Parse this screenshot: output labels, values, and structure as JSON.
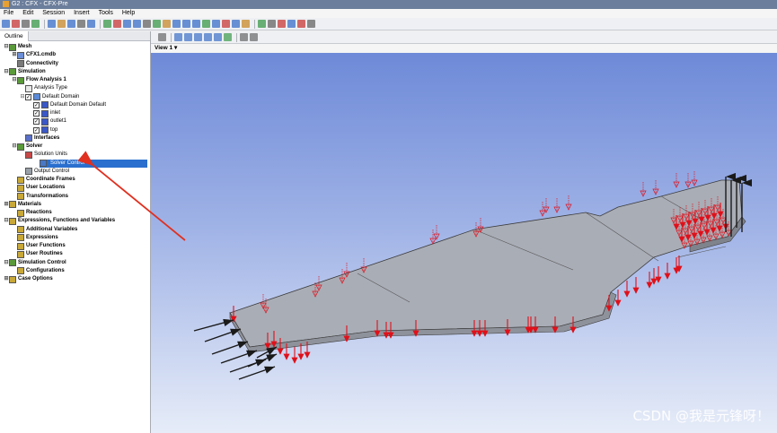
{
  "window": {
    "title": "G2 : CFX - CFX-Pre"
  },
  "menu": [
    "File",
    "Edit",
    "Session",
    "Insert",
    "Tools",
    "Help"
  ],
  "outline_tab": "Outline",
  "view": {
    "label": "View 1",
    "dropdown_glyph": "▾"
  },
  "tree": [
    {
      "label": "Mesh",
      "bold": true,
      "depth": 0,
      "expander": "⊟",
      "icon": "mesh-icon",
      "color": "#5b9a3a"
    },
    {
      "label": "CFX1.cmdb",
      "bold": true,
      "depth": 1,
      "expander": "⊞",
      "icon": "mesh-file-icon",
      "color": "#6b8ed6"
    },
    {
      "label": "Connectivity",
      "bold": true,
      "depth": 1,
      "expander": "",
      "icon": "connectivity-icon",
      "color": "#7a7a7a"
    },
    {
      "label": "Simulation",
      "bold": true,
      "depth": 0,
      "expander": "⊟",
      "icon": "simulation-icon",
      "color": "#5b9a3a"
    },
    {
      "label": "Flow Analysis 1",
      "bold": true,
      "depth": 1,
      "expander": "⊟",
      "icon": "flow-analysis-icon",
      "color": "#5b9a3a"
    },
    {
      "label": "Analysis Type",
      "bold": false,
      "depth": 2,
      "expander": "",
      "icon": "clock-icon",
      "color": "#e8e8e8"
    },
    {
      "label": "Default Domain",
      "bold": false,
      "depth": 2,
      "expander": "⊟",
      "icon": "domain-icon",
      "color": "#5a8ad8",
      "check": true
    },
    {
      "label": "Default Domain Default",
      "bold": false,
      "depth": 3,
      "expander": "",
      "icon": "boundary-icon",
      "color": "#3a58c8",
      "check": true
    },
    {
      "label": "inlet",
      "bold": false,
      "depth": 3,
      "expander": "",
      "icon": "inlet-icon",
      "color": "#3a58c8",
      "check": true
    },
    {
      "label": "outlet1",
      "bold": false,
      "depth": 3,
      "expander": "",
      "icon": "outlet-icon",
      "color": "#3a58c8",
      "check": true
    },
    {
      "label": "top",
      "bold": false,
      "depth": 3,
      "expander": "",
      "icon": "wall-icon",
      "color": "#3a58c8",
      "check": true
    },
    {
      "label": "Interfaces",
      "bold": true,
      "depth": 2,
      "expander": "",
      "icon": "interfaces-icon",
      "color": "#5a70c8"
    },
    {
      "label": "Solver",
      "bold": true,
      "depth": 1,
      "expander": "⊟",
      "icon": "solver-icon",
      "color": "#5b9a3a"
    },
    {
      "label": "Solution Units",
      "bold": false,
      "depth": 2,
      "expander": "",
      "icon": "units-icon",
      "color": "#c84848"
    },
    {
      "label": "Solver Control",
      "bold": false,
      "depth": 2,
      "expander": "",
      "icon": "solver-control-icon",
      "color": "#4878c8",
      "selected": true
    },
    {
      "label": "Output Control",
      "bold": false,
      "depth": 2,
      "expander": "",
      "icon": "output-control-icon",
      "color": "#9aa0a8"
    },
    {
      "label": "Coordinate Frames",
      "bold": true,
      "depth": 0,
      "expander": "",
      "icon": "coordinate-frames-icon",
      "color": "#c8a838",
      "indent": 1
    },
    {
      "label": "User Locations",
      "bold": true,
      "depth": 0,
      "expander": "",
      "icon": "user-locations-icon",
      "color": "#c8a838",
      "indent": 1
    },
    {
      "label": "Transformations",
      "bold": true,
      "depth": 0,
      "expander": "",
      "icon": "transformations-icon",
      "color": "#c8a838",
      "indent": 1
    },
    {
      "label": "Materials",
      "bold": true,
      "depth": 0,
      "expander": "⊞",
      "icon": "materials-icon",
      "color": "#c8a838"
    },
    {
      "label": "Reactions",
      "bold": true,
      "depth": 0,
      "expander": "",
      "icon": "reactions-icon",
      "color": "#c8a838",
      "indent": 1
    },
    {
      "label": "Expressions, Functions and Variables",
      "bold": true,
      "depth": 0,
      "expander": "⊟",
      "icon": "expressions-icon",
      "color": "#c8a838"
    },
    {
      "label": "Additional Variables",
      "bold": true,
      "depth": 1,
      "expander": "",
      "icon": "variables-icon",
      "color": "#c8a838"
    },
    {
      "label": "Expressions",
      "bold": true,
      "depth": 1,
      "expander": "",
      "icon": "expression-icon",
      "color": "#c8a838"
    },
    {
      "label": "User Functions",
      "bold": true,
      "depth": 1,
      "expander": "",
      "icon": "user-functions-icon",
      "color": "#c8a838"
    },
    {
      "label": "User Routines",
      "bold": true,
      "depth": 1,
      "expander": "",
      "icon": "user-routines-icon",
      "color": "#c8a838"
    },
    {
      "label": "Simulation Control",
      "bold": true,
      "depth": 0,
      "expander": "⊟",
      "icon": "simulation-control-icon",
      "color": "#5b9a3a"
    },
    {
      "label": "Configurations",
      "bold": true,
      "depth": 1,
      "expander": "",
      "icon": "configurations-icon",
      "color": "#c8a838"
    },
    {
      "label": "Case Options",
      "bold": true,
      "depth": 0,
      "expander": "⊞",
      "icon": "case-options-icon",
      "color": "#c8a838"
    }
  ],
  "watermark": "CSDN @我是元锋呀！",
  "colors": {
    "selection": "#2a6fce",
    "annotation_arrow": "#e03020",
    "boundary_arrow": "#e0101a",
    "inlet_arrow": "#1a1a1a",
    "model_fill": "#a9adb6"
  }
}
